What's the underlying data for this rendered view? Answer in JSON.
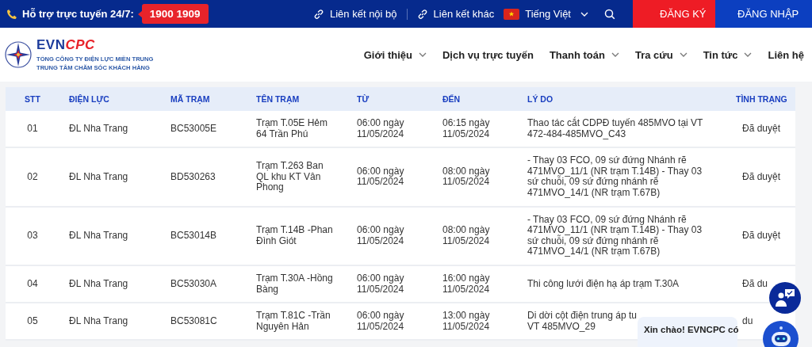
{
  "topbar": {
    "support_label": "Hỗ trợ trực tuyến 24/7:",
    "hotline": "1900 1909",
    "links": [
      "Liên kết nội bộ",
      "Liên kết khác"
    ],
    "language": "Tiếng Việt",
    "register": "ĐĂNG KÝ",
    "login": "ĐĂNG NHẬP"
  },
  "header": {
    "logo_text": [
      "EVN",
      "CPC"
    ],
    "org_lines": [
      "TỔNG CÔNG TY ĐIỆN LỰC MIỀN TRUNG",
      "TRUNG TÂM CHĂM SÓC KHÁCH HÀNG"
    ],
    "nav": [
      {
        "label": "Giới thiệu",
        "has_menu": true
      },
      {
        "label": "Dịch vụ trực tuyến",
        "has_menu": false
      },
      {
        "label": "Thanh toán",
        "has_menu": true
      },
      {
        "label": "Tra cứu",
        "has_menu": true
      },
      {
        "label": "Tin tức",
        "has_menu": true
      },
      {
        "label": "Liên hệ",
        "has_menu": false
      }
    ]
  },
  "table": {
    "columns": [
      "STT",
      "ĐIỆN LỰC",
      "MÃ TRẠM",
      "TÊN TRẠM",
      "TỪ",
      "ĐẾN",
      "LÝ DO",
      "TÌNH TRẠNG"
    ],
    "rows": [
      [
        "01",
        "ĐL Nha Trang",
        "BC53005E",
        "Trạm T.05E Hẻm 64 Trần Phú",
        "06:00 ngày 11/05/2024",
        "06:15 ngày 11/05/2024",
        "Thao tác cắt CDPĐ tuyến 485MVO tại VT 472-484-485MVO_C43",
        "Đã duyệt"
      ],
      [
        "02",
        "ĐL Nha Trang",
        "BD530263",
        "Trạm T.263 Ban QL khu KT Vân Phong",
        "06:00 ngày 11/05/2024",
        "08:00 ngày 11/05/2024",
        "- Thay 03 FCO, 09 sứ đứng Nhánh rẽ 471MVO_11/1 (NR trạm T.14B) - Thay 03 sứ chuỗi, 09 sứ đứng nhánh rẽ 471MVO_14/1 (NR trạm T.67B)",
        "Đã duyệt"
      ],
      [
        "03",
        "ĐL Nha Trang",
        "BC53014B",
        "Trạm T.14B -Phan Đình Giót",
        "06:00 ngày 11/05/2024",
        "08:00 ngày 11/05/2024",
        "- Thay 03 FCO, 09 sứ đứng Nhánh rẽ 471MVO_11/1 (NR trạm T.14B) - Thay 03 sứ chuỗi, 09 sứ đứng nhánh rẽ 471MVO_14/1 (NR trạm T.67B)",
        "Đã duyệt"
      ],
      [
        "04",
        "ĐL Nha Trang",
        "BC53030A",
        "Trạm T.30A -Hồng Bàng",
        "06:00 ngày 11/05/2024",
        "16:00 ngày 11/05/2024",
        "Thi công lưới điện hạ áp trạm T.30A",
        "Đã du"
      ],
      [
        "05",
        "ĐL Nha Trang",
        "BC53081C",
        "Trạm T.81C -Trần Nguyên Hản",
        "06:00 ngày 11/05/2024",
        "13:00 ngày 11/05/2024",
        "Di dời cột điện trung áp tu\nVT 485MVO_29",
        "du"
      ]
    ]
  },
  "chat": {
    "greeting": "Xin chào! EVNCPC có"
  }
}
